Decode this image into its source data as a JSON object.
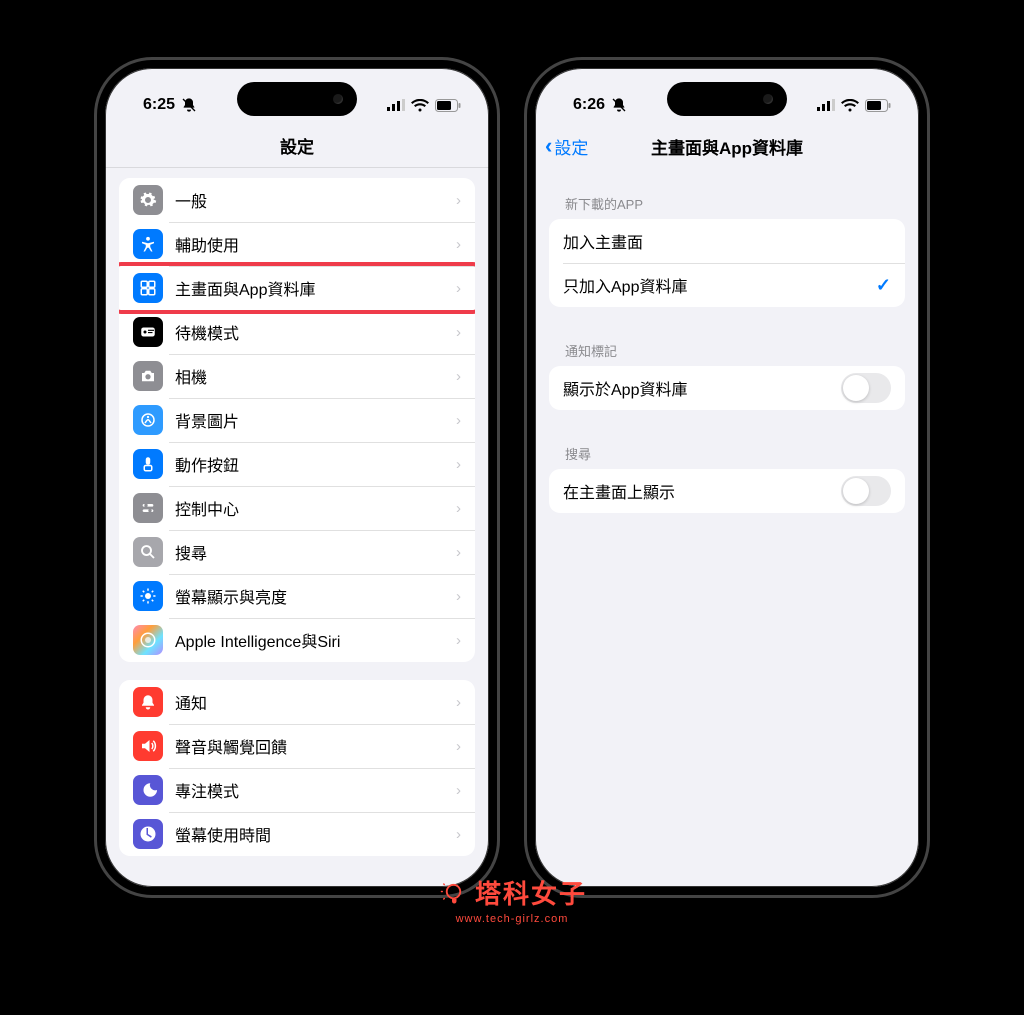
{
  "left": {
    "time": "6:25",
    "title": "設定",
    "groups": [
      {
        "rows": [
          {
            "label": "一般",
            "icon": "gear-icon",
            "bg": "bg-gray"
          },
          {
            "label": "輔助使用",
            "icon": "accessibility-icon",
            "bg": "bg-blue"
          },
          {
            "label": "主畫面與App資料庫",
            "icon": "apps-icon",
            "bg": "bg-blue",
            "highlighted": true
          },
          {
            "label": "待機模式",
            "icon": "standby-icon",
            "bg": "bg-black"
          },
          {
            "label": "相機",
            "icon": "camera-icon",
            "bg": "bg-gray"
          },
          {
            "label": "背景圖片",
            "icon": "wallpaper-icon",
            "bg": "bg-bluebr"
          },
          {
            "label": "動作按鈕",
            "icon": "action-icon",
            "bg": "bg-blue"
          },
          {
            "label": "控制中心",
            "icon": "control-icon",
            "bg": "bg-gray"
          },
          {
            "label": "搜尋",
            "icon": "search-icon",
            "bg": "bg-graylt"
          },
          {
            "label": "螢幕顯示與亮度",
            "icon": "brightness-icon",
            "bg": "bg-blue"
          },
          {
            "label": "Apple Intelligence與Siri",
            "icon": "ai-icon",
            "bg": "bg-grad"
          }
        ]
      },
      {
        "rows": [
          {
            "label": "通知",
            "icon": "notification-icon",
            "bg": "bg-red"
          },
          {
            "label": "聲音與觸覺回饋",
            "icon": "sound-icon",
            "bg": "bg-red"
          },
          {
            "label": "專注模式",
            "icon": "focus-icon",
            "bg": "bg-purple"
          },
          {
            "label": "螢幕使用時間",
            "icon": "screentime-icon",
            "bg": "bg-purple"
          }
        ]
      }
    ]
  },
  "right": {
    "time": "6:26",
    "back_label": "設定",
    "title": "主畫面與App資料庫",
    "sections": [
      {
        "header": "新下載的APP",
        "rows": [
          {
            "label": "加入主畫面",
            "type": "check",
            "checked": false
          },
          {
            "label": "只加入App資料庫",
            "type": "check",
            "checked": true
          }
        ]
      },
      {
        "header": "通知標記",
        "rows": [
          {
            "label": "顯示於App資料庫",
            "type": "toggle",
            "on": false
          }
        ]
      },
      {
        "header": "搜尋",
        "rows": [
          {
            "label": "在主畫面上顯示",
            "type": "toggle",
            "on": false,
            "highlighted": true
          }
        ]
      }
    ]
  },
  "watermark": {
    "brand": "塔科女子",
    "url": "www.tech-girlz.com"
  }
}
